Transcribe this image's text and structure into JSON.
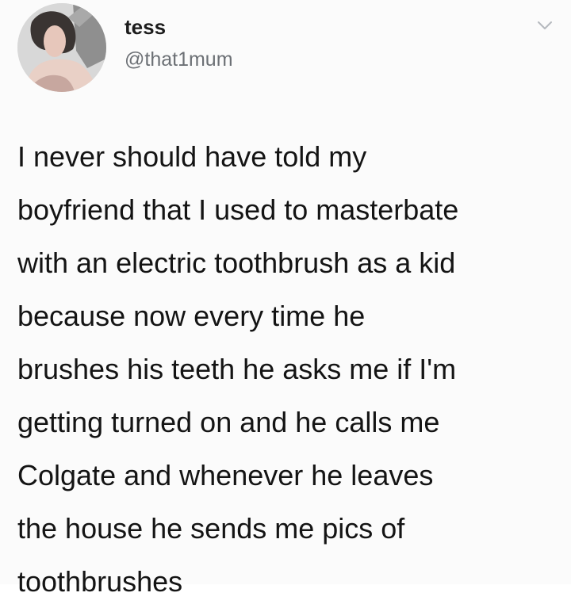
{
  "user": {
    "display_name": "tess",
    "handle": "@that1mum",
    "avatar_icon": "profile-photo"
  },
  "tweet": {
    "lines": [
      "I never should have told my",
      "boyfriend that I used to masterbate",
      "with an electric toothbrush as a kid",
      "because now every time he",
      "brushes his teeth he asks me if I'm",
      "getting turned on and he calls me",
      "Colgate and whenever he leaves",
      "the house he sends me pics of",
      "toothbrushes"
    ]
  },
  "menu": {
    "icon": "chevron-down-icon"
  },
  "colors": {
    "background": "#fbfbfb",
    "text": "#141414",
    "handle": "#6c7075",
    "chevron": "#b5b9be"
  }
}
